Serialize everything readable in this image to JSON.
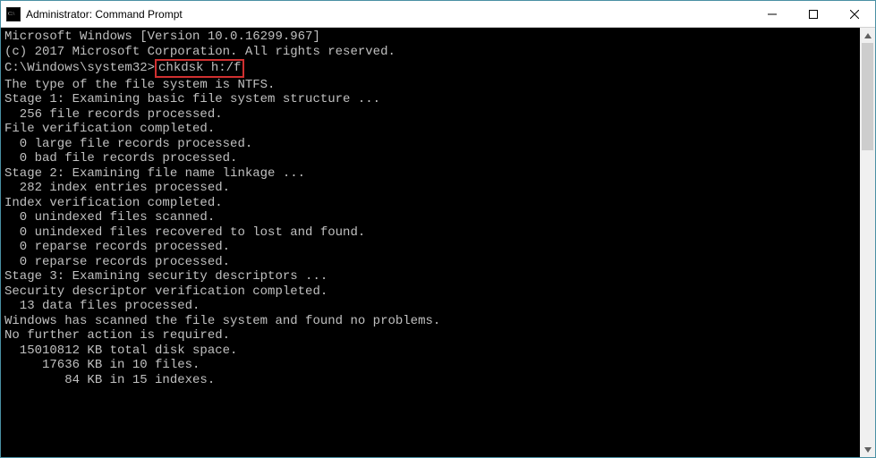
{
  "window": {
    "title": "Administrator: Command Prompt"
  },
  "terminal": {
    "header1": "Microsoft Windows [Version 10.0.16299.967]",
    "header2": "(c) 2017 Microsoft Corporation. All rights reserved.",
    "prompt_path": "C:\\Windows\\system32>",
    "command": "chkdsk h:/f",
    "lines": [
      "The type of the file system is NTFS.",
      "",
      "Stage 1: Examining basic file system structure ...",
      "  256 file records processed.",
      "File verification completed.",
      "  0 large file records processed.",
      "  0 bad file records processed.",
      "",
      "Stage 2: Examining file name linkage ...",
      "  282 index entries processed.",
      "Index verification completed.",
      "  0 unindexed files scanned.",
      "  0 unindexed files recovered to lost and found.",
      "  0 reparse records processed.",
      "  0 reparse records processed.",
      "",
      "Stage 3: Examining security descriptors ...",
      "Security descriptor verification completed.",
      "  13 data files processed.",
      "",
      "Windows has scanned the file system and found no problems.",
      "No further action is required.",
      "",
      "  15010812 KB total disk space.",
      "     17636 KB in 10 files.",
      "        84 KB in 15 indexes."
    ]
  }
}
